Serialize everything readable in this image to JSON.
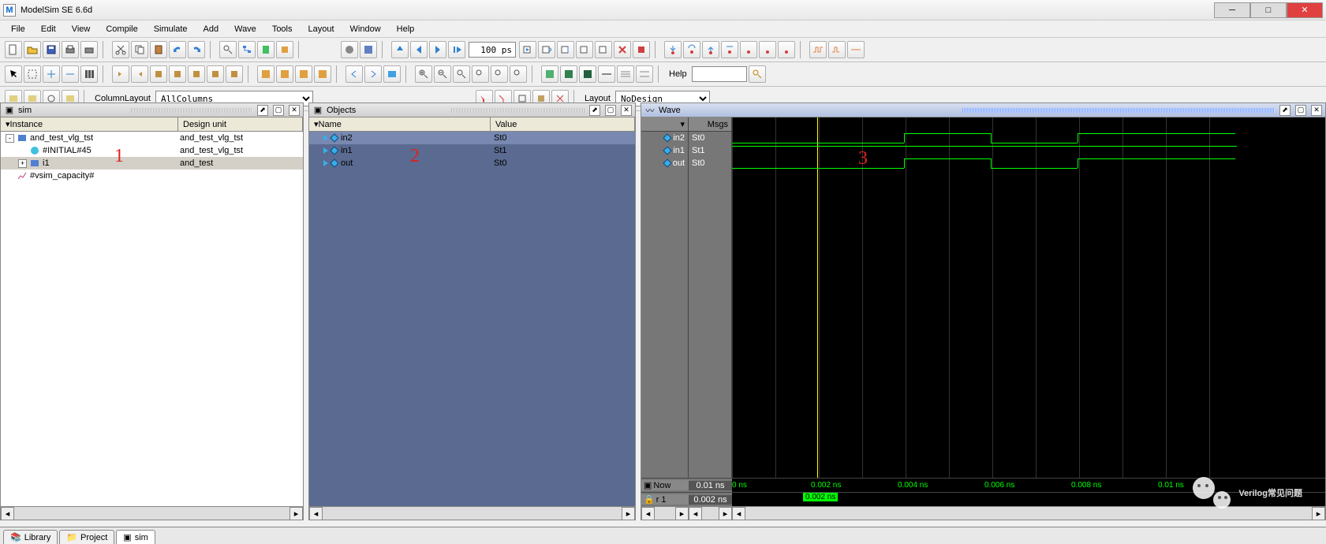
{
  "window": {
    "title": "ModelSim SE 6.6d",
    "icon_letter": "M"
  },
  "menu": [
    "File",
    "Edit",
    "View",
    "Compile",
    "Simulate",
    "Add",
    "Wave",
    "Tools",
    "Layout",
    "Window",
    "Help"
  ],
  "toolbar1": {
    "time_value": "100 ps"
  },
  "toolbar2": {
    "help_label": "Help"
  },
  "layout_row": {
    "column_label": "ColumnLayout",
    "column_value": "AllColumns",
    "layout_label": "Layout",
    "layout_value": "NoDesign"
  },
  "sim_panel": {
    "title": "sim",
    "cols": [
      "Instance",
      "Design unit"
    ],
    "rows": [
      {
        "indent": 0,
        "exp": "-",
        "icon": "module",
        "name": "and_test_vlg_tst",
        "unit": "and_test_vlg_tst"
      },
      {
        "indent": 1,
        "exp": "",
        "icon": "process",
        "name": "#INITIAL#45",
        "unit": "and_test_vlg_tst"
      },
      {
        "indent": 1,
        "exp": "+",
        "icon": "module",
        "name": "i1",
        "unit": "and_test",
        "sel": true
      },
      {
        "indent": 0,
        "exp": "",
        "icon": "graph",
        "name": "#vsim_capacity#",
        "unit": ""
      }
    ]
  },
  "objects_panel": {
    "title": "Objects",
    "cols": [
      "Name",
      "Value"
    ],
    "rows": [
      {
        "name": "in2",
        "value": "St0",
        "sel": true
      },
      {
        "name": "in1",
        "value": "St1"
      },
      {
        "name": "out",
        "value": "St0"
      }
    ]
  },
  "wave_panel": {
    "title": "Wave",
    "msgs_label": "Msgs",
    "signals": [
      {
        "name": "in2",
        "value": "St0"
      },
      {
        "name": "in1",
        "value": "St1"
      },
      {
        "name": "out",
        "value": "St0"
      }
    ],
    "now_label": "Now",
    "now_value": "0.01 ns",
    "cursor_label": "r 1",
    "cursor_value": "0.002 ns",
    "time_ticks": [
      "0 ns",
      "0.002 ns",
      "0.004 ns",
      "0.006 ns",
      "0.008 ns",
      "0.01 ns"
    ],
    "cursor_box": "0.002 ns"
  },
  "annotations": {
    "a1": "1",
    "a2": "2",
    "a3": "3"
  },
  "bottom_tabs": [
    "Library",
    "Project",
    "sim"
  ],
  "watermark": "Verilog常见问题"
}
